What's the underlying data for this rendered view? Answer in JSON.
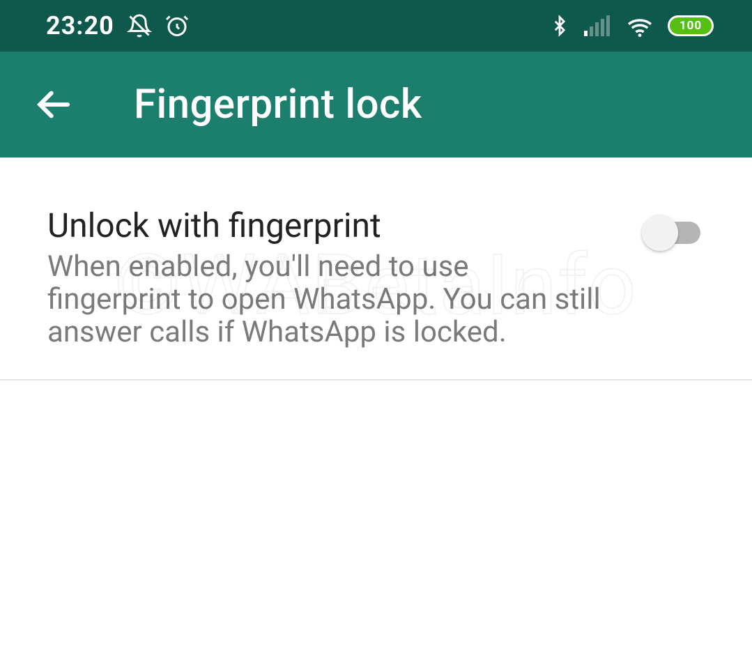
{
  "status": {
    "time": "23:20",
    "battery": "100"
  },
  "appbar": {
    "title": "Fingerprint lock"
  },
  "setting": {
    "title": "Unlock with fingerprint",
    "description": "When enabled, you'll need to use fingerprint to open WhatsApp. You can still answer calls if WhatsApp is locked.",
    "enabled": false
  },
  "watermark": "©WABetaInfo"
}
